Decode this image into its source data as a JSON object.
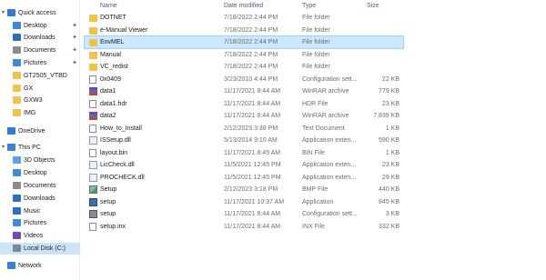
{
  "nav": {
    "items": [
      {
        "label": "Quick access",
        "icon": "star-icon",
        "chev": "▾",
        "pinned": false,
        "indent": 0,
        "color": "#2f7bd6"
      },
      {
        "label": "Desktop",
        "icon": "desktop-icon",
        "chev": "",
        "pinned": true,
        "indent": 1,
        "color": "#3d8ad9"
      },
      {
        "label": "Downloads",
        "icon": "download-icon",
        "chev": "",
        "pinned": true,
        "indent": 1,
        "color": "#2f6fbf"
      },
      {
        "label": "Documents",
        "icon": "documents-icon",
        "chev": "",
        "pinned": true,
        "indent": 1,
        "color": "#8c8c8c"
      },
      {
        "label": "Pictures",
        "icon": "pictures-icon",
        "chev": "",
        "pinned": true,
        "indent": 1,
        "color": "#3d8ad9"
      },
      {
        "label": "GT2505_VTBD",
        "icon": "folder-icon",
        "chev": "",
        "pinned": false,
        "indent": 1,
        "color": "#f0c44c"
      },
      {
        "label": "GX",
        "icon": "folder-icon",
        "chev": "",
        "pinned": false,
        "indent": 1,
        "color": "#f0c44c"
      },
      {
        "label": "GXW3",
        "icon": "folder-icon",
        "chev": "",
        "pinned": false,
        "indent": 1,
        "color": "#f0c44c"
      },
      {
        "label": "IMG",
        "icon": "folder-icon",
        "chev": "",
        "pinned": false,
        "indent": 1,
        "color": "#f0c44c"
      },
      {
        "label": "OneDrive",
        "icon": "cloud-icon",
        "chev": "",
        "pinned": false,
        "indent": 0,
        "color": "#2f7bd6"
      },
      {
        "label": "This PC",
        "icon": "computer-icon",
        "chev": "▾",
        "pinned": false,
        "indent": 0,
        "color": "#3a83d1"
      },
      {
        "label": "3D Objects",
        "icon": "cube-icon",
        "chev": "",
        "pinned": false,
        "indent": 1,
        "color": "#5aa3e6"
      },
      {
        "label": "Desktop",
        "icon": "desktop-icon",
        "chev": "",
        "pinned": false,
        "indent": 1,
        "color": "#3d8ad9"
      },
      {
        "label": "Documents",
        "icon": "documents-icon",
        "chev": "",
        "pinned": false,
        "indent": 1,
        "color": "#8c8c8c"
      },
      {
        "label": "Downloads",
        "icon": "download-icon",
        "chev": "",
        "pinned": false,
        "indent": 1,
        "color": "#2f6fbf"
      },
      {
        "label": "Music",
        "icon": "music-icon",
        "chev": "",
        "pinned": false,
        "indent": 1,
        "color": "#2f6fbf"
      },
      {
        "label": "Pictures",
        "icon": "pictures-icon",
        "chev": "",
        "pinned": false,
        "indent": 1,
        "color": "#3d8ad9"
      },
      {
        "label": "Videos",
        "icon": "video-icon",
        "chev": "",
        "pinned": false,
        "indent": 1,
        "color": "#6b4fb8"
      },
      {
        "label": "Local Disk (C:)",
        "icon": "drive-icon",
        "chev": "",
        "pinned": false,
        "indent": 1,
        "color": "#7b8894",
        "selected": true
      },
      {
        "label": "Network",
        "icon": "network-icon",
        "chev": "",
        "pinned": false,
        "indent": 0,
        "color": "#3a83d1"
      }
    ]
  },
  "columns": {
    "name": "Name",
    "date": "Date modified",
    "type": "Type",
    "size": "Size"
  },
  "files": [
    {
      "name": "DOTNET",
      "date": "7/18/2022 2:44 PM",
      "type": "File folder",
      "size": "",
      "icon": "folder-icon",
      "kind": "folder"
    },
    {
      "name": "e-Manual Viewer",
      "date": "7/18/2022 2:44 PM",
      "type": "File folder",
      "size": "",
      "icon": "folder-icon",
      "kind": "folder"
    },
    {
      "name": "EnvMEL",
      "date": "7/18/2022 2:44 PM",
      "type": "File folder",
      "size": "",
      "icon": "folder-icon",
      "kind": "folder",
      "selected": true
    },
    {
      "name": "Manual",
      "date": "7/18/2022 2:44 PM",
      "type": "File folder",
      "size": "",
      "icon": "folder-icon",
      "kind": "folder"
    },
    {
      "name": "VC_redist",
      "date": "7/18/2022 2:44 PM",
      "type": "File folder",
      "size": "",
      "icon": "folder-icon",
      "kind": "folder"
    },
    {
      "name": "0x0409",
      "date": "3/23/2010 4:44 PM",
      "type": "Configuration sett...",
      "size": "22 KB",
      "icon": "config-file-icon",
      "kind": "doc"
    },
    {
      "name": "data1",
      "date": "11/17/2021 8:44 AM",
      "type": "WinRAR archive",
      "size": "779 KB",
      "icon": "archive-icon",
      "kind": "rar"
    },
    {
      "name": "data1.hdr",
      "date": "11/17/2021 8:44 AM",
      "type": "HDR File",
      "size": "23 KB",
      "icon": "file-icon",
      "kind": "doc"
    },
    {
      "name": "data2",
      "date": "11/17/2021 8:44 AM",
      "type": "WinRAR archive",
      "size": "7,839 KB",
      "icon": "archive-icon",
      "kind": "rar"
    },
    {
      "name": "How_to_Install",
      "date": "2/12/2023 3:38 PM",
      "type": "Text Document",
      "size": "1 KB",
      "icon": "text-file-icon",
      "kind": "doc"
    },
    {
      "name": "ISSetup.dll",
      "date": "5/13/2014 9:10 AM",
      "type": "Application exten...",
      "size": "590 KB",
      "icon": "dll-icon",
      "kind": "dll"
    },
    {
      "name": "layout.bin",
      "date": "11/17/2021 8:45 AM",
      "type": "BIN File",
      "size": "1 KB",
      "icon": "file-icon",
      "kind": "doc"
    },
    {
      "name": "LicCheck.dll",
      "date": "11/5/2021 12:45 PM",
      "type": "Application exten...",
      "size": "23 KB",
      "icon": "dll-icon",
      "kind": "dll"
    },
    {
      "name": "PROCHECK.dll",
      "date": "11/5/2021 12:45 PM",
      "type": "Application exten...",
      "size": "29 KB",
      "icon": "dll-icon",
      "kind": "dll"
    },
    {
      "name": "Setup",
      "date": "2/12/2023 3:18 PM",
      "type": "BMP File",
      "size": "440 KB",
      "icon": "image-file-icon",
      "kind": "bmp"
    },
    {
      "name": "setup",
      "date": "11/17/2021 10:37 AM",
      "type": "Application",
      "size": "845 KB",
      "icon": "application-icon",
      "kind": "app"
    },
    {
      "name": "setup",
      "date": "11/17/2021 8:44 AM",
      "type": "Configuration sett...",
      "size": "3 KB",
      "icon": "config-file-icon",
      "kind": "set"
    },
    {
      "name": "setup.inx",
      "date": "11/17/2021 8:44 AM",
      "type": "INX File",
      "size": "332 KB",
      "icon": "file-icon",
      "kind": "doc"
    }
  ]
}
